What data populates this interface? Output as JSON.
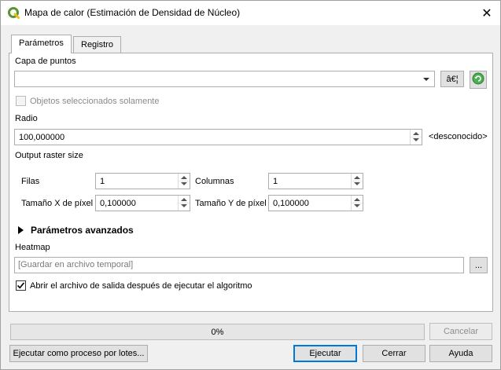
{
  "window": {
    "title": "Mapa de calor (Estimación de Densidad de Núcleo)",
    "close_glyph": "✕"
  },
  "tabs": [
    {
      "label": "Parámetros"
    },
    {
      "label": "Registro"
    }
  ],
  "points_layer": {
    "label": "Capa de puntos",
    "value": "",
    "options_button": "â€¦",
    "selected_only_label": "Objetos seleccionados solamente"
  },
  "radius": {
    "label": "Radio",
    "value": "100,000000",
    "unit": "<desconocido>"
  },
  "output_raster": {
    "label": "Output raster size",
    "rows_label": "Filas",
    "rows_value": "1",
    "cols_label": "Columnas",
    "cols_value": "1",
    "pixel_x_label": "Tamaño X de píxel",
    "pixel_x_value": "0,100000",
    "pixel_y_label": "Tamaño Y de píxel",
    "pixel_y_value": "0,100000"
  },
  "advanced": {
    "label": "Parámetros avanzados"
  },
  "heatmap": {
    "label": "Heatmap",
    "placeholder": "[Guardar en archivo temporal]",
    "browse_label": "...",
    "open_after_label": "Abrir el archivo de salida después de ejecutar el algoritmo",
    "open_after_checked": true
  },
  "progress": {
    "text": "0%",
    "value": 0
  },
  "buttons": {
    "cancel": "Cancelar",
    "batch": "Ejecutar como proceso por lotes...",
    "run": "Ejecutar",
    "close": "Cerrar",
    "help": "Ayuda"
  },
  "colors": {
    "qgis_green": "#589632",
    "accent": "#0078d7"
  },
  "icons": {
    "app": "qgis-logo-icon",
    "refresh": "refresh-icon"
  }
}
